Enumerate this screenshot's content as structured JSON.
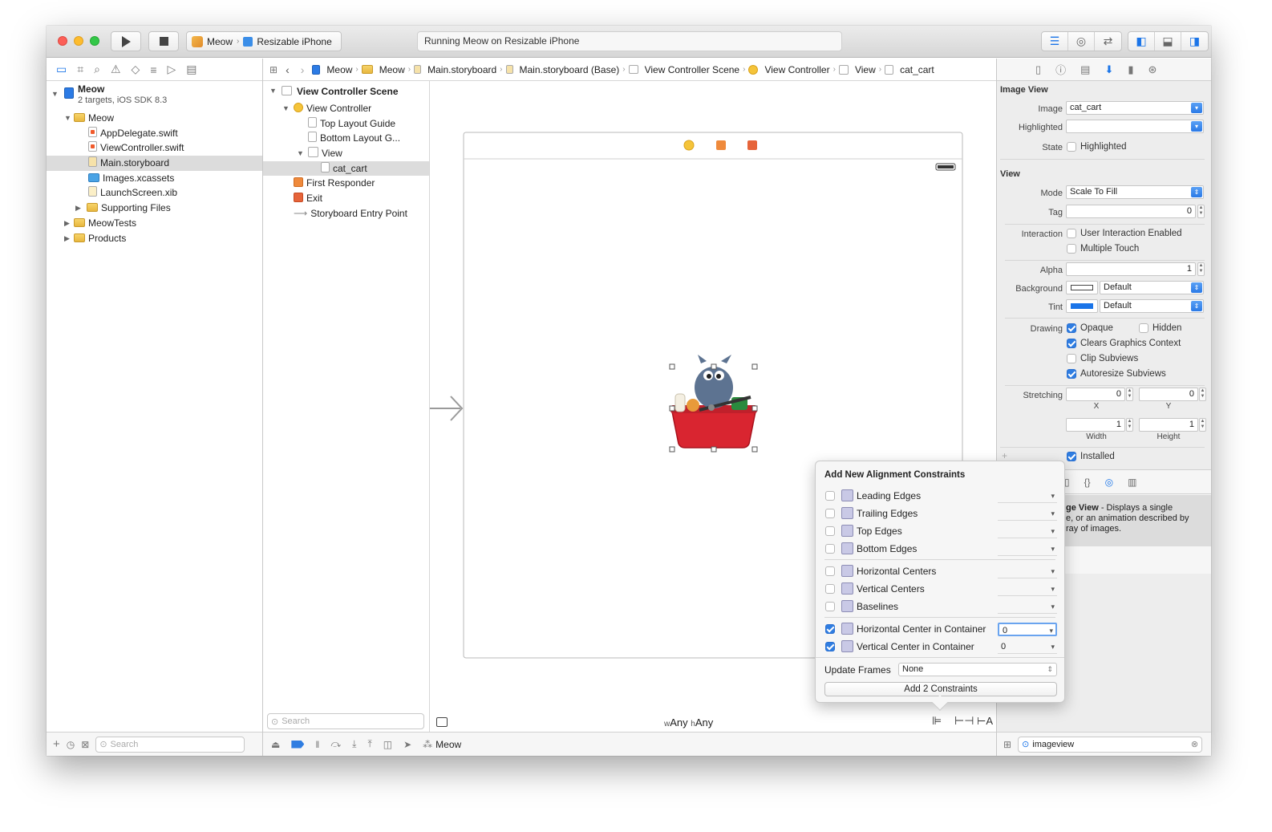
{
  "toolbar": {
    "scheme_target": "Meow",
    "scheme_device": "Resizable iPhone",
    "activity": "Running Meow on Resizable iPhone"
  },
  "navigator": {
    "project_name": "Meow",
    "project_sub": "2 targets, iOS SDK 8.3",
    "items": [
      {
        "label": "Meow"
      },
      {
        "label": "AppDelegate.swift"
      },
      {
        "label": "ViewController.swift"
      },
      {
        "label": "Main.storyboard"
      },
      {
        "label": "Images.xcassets"
      },
      {
        "label": "LaunchScreen.xib"
      },
      {
        "label": "Supporting Files"
      },
      {
        "label": "MeowTests"
      },
      {
        "label": "Products"
      }
    ],
    "filter_placeholder": "Search"
  },
  "jumpbar": [
    {
      "label": "Meow"
    },
    {
      "label": "Meow"
    },
    {
      "label": "Main.storyboard"
    },
    {
      "label": "Main.storyboard (Base)"
    },
    {
      "label": "View Controller Scene"
    },
    {
      "label": "View Controller"
    },
    {
      "label": "View"
    },
    {
      "label": "cat_cart"
    }
  ],
  "outline": {
    "scene": "View Controller Scene",
    "items": [
      {
        "label": "View Controller"
      },
      {
        "label": "Top Layout Guide"
      },
      {
        "label": "Bottom Layout G..."
      },
      {
        "label": "View"
      },
      {
        "label": "cat_cart"
      },
      {
        "label": "First Responder"
      },
      {
        "label": "Exit"
      },
      {
        "label": "Storyboard Entry Point"
      }
    ],
    "filter_placeholder": "Search"
  },
  "canvas": {
    "size_w_prefix": "w",
    "size_w": "Any",
    "size_h_prefix": "h",
    "size_h": "Any"
  },
  "bottombar": {
    "debug_target": "Meow"
  },
  "inspector": {
    "image_view_title": "Image View",
    "image_label": "Image",
    "image_value": "cat_cart",
    "highlighted_label": "Highlighted",
    "state_label": "State",
    "state_check": "Highlighted",
    "view_title": "View",
    "mode_label": "Mode",
    "mode_value": "Scale To Fill",
    "tag_label": "Tag",
    "tag_value": "0",
    "interaction_label": "Interaction",
    "user_interaction": "User Interaction Enabled",
    "multiple_touch": "Multiple Touch",
    "alpha_label": "Alpha",
    "alpha_value": "1",
    "background_label": "Background",
    "background_value": "Default",
    "tint_label": "Tint",
    "tint_value": "Default",
    "drawing_label": "Drawing",
    "opaque": "Opaque",
    "hidden": "Hidden",
    "clears_graphics": "Clears Graphics Context",
    "clip_subviews": "Clip Subviews",
    "autoresize_subviews": "Autoresize Subviews",
    "stretching_label": "Stretching",
    "stretch_x": "0",
    "stretch_y": "0",
    "stretch_w": "1",
    "stretch_h": "1",
    "x_label": "X",
    "y_label": "Y",
    "width_label": "Width",
    "height_label": "Height",
    "installed": "Installed",
    "help_title": "ge View",
    "help_text_1": " - Displays a single",
    "help_text_2": "e, or an animation described by",
    "help_text_3": "ray of images.",
    "library_filter": "imageview",
    "tint_color": "#1a74e8"
  },
  "popover": {
    "title": "Add New Alignment Constraints",
    "rows": [
      {
        "label": "Leading Edges",
        "value": ""
      },
      {
        "label": "Trailing Edges",
        "value": ""
      },
      {
        "label": "Top Edges",
        "value": ""
      },
      {
        "label": "Bottom Edges",
        "value": ""
      },
      {
        "label": "Horizontal Centers",
        "value": ""
      },
      {
        "label": "Vertical Centers",
        "value": ""
      },
      {
        "label": "Baselines",
        "value": ""
      },
      {
        "label": "Horizontal Center in Container",
        "value": "0"
      },
      {
        "label": "Vertical Center in Container",
        "value": "0"
      }
    ],
    "update_frames_label": "Update Frames",
    "update_frames_value": "None",
    "add_button": "Add 2 Constraints"
  }
}
